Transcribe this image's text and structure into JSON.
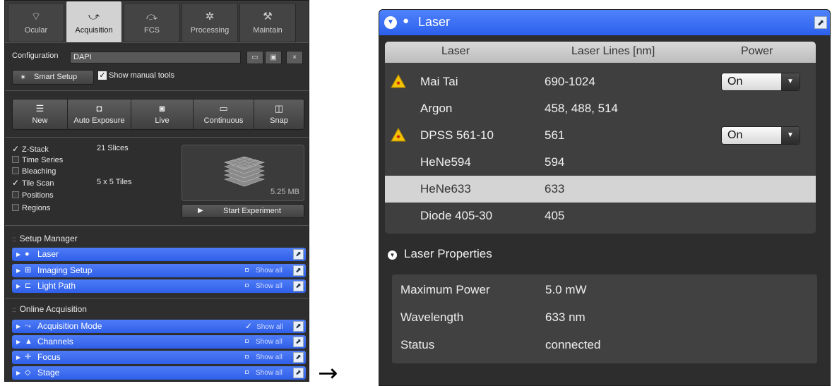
{
  "left": {
    "tabs": [
      {
        "label": "Ocular",
        "icon": "eyepiece-icon"
      },
      {
        "label": "Acquisition",
        "icon": "acquisition-icon"
      },
      {
        "label": "FCS",
        "icon": "fcs-icon"
      },
      {
        "label": "Processing",
        "icon": "processing-icon"
      },
      {
        "label": "Maintain",
        "icon": "maintain-icon"
      }
    ],
    "config_label": "Configuration",
    "config_value": "DAPI",
    "config_buttons": [
      "open-icon",
      "save-icon",
      "close-icon"
    ],
    "config_close": "×",
    "smart_setup": "Smart Setup",
    "show_manual_tools": "Show manual tools",
    "actions": [
      {
        "label": "New",
        "icon": "new-icon"
      },
      {
        "label": "Auto Exposure",
        "icon": "camera-icon"
      },
      {
        "label": "Live",
        "icon": "live-icon"
      },
      {
        "label": "Continuous",
        "icon": "continuous-icon"
      },
      {
        "label": "Snap",
        "icon": "snap-icon"
      }
    ],
    "experiment_options": [
      {
        "label": "Z-Stack",
        "checked": true,
        "value": "21 Slices"
      },
      {
        "label": "Time Series",
        "checked": false,
        "value": ""
      },
      {
        "label": "Bleaching",
        "checked": false,
        "value": ""
      },
      {
        "label": "Tile Scan",
        "checked": true,
        "value": "5 x 5 Tiles"
      },
      {
        "label": "Positions",
        "checked": false,
        "value": ""
      },
      {
        "label": "Regions",
        "checked": false,
        "value": ""
      }
    ],
    "preview_size": "5.25 MB",
    "start_experiment": "Start Experiment",
    "setup_manager_title": "Setup Manager",
    "setup_tools": [
      {
        "label": "Laser",
        "icon": "bulb-icon",
        "show_all": null
      },
      {
        "label": "Imaging Setup",
        "icon": "grid-icon",
        "show_all": "Show all",
        "checked": false
      },
      {
        "label": "Light Path",
        "icon": "lightpath-icon",
        "show_all": "Show all",
        "checked": false
      }
    ],
    "online_acquisition_title": "Online Acquisition",
    "acquisition_tools": [
      {
        "label": "Acquisition Mode",
        "icon": "mode-icon",
        "show_all": "Show all",
        "checked": true
      },
      {
        "label": "Channels",
        "icon": "channels-icon",
        "show_all": "Show all",
        "checked": false
      },
      {
        "label": "Focus",
        "icon": "focus-icon",
        "show_all": "Show all",
        "checked": false
      },
      {
        "label": "Stage",
        "icon": "stage-icon",
        "show_all": "Show all",
        "checked": false
      }
    ]
  },
  "arrow": "→",
  "right": {
    "title": "Laser",
    "columns": [
      "Laser",
      "Laser Lines [nm]",
      "Power"
    ],
    "lasers": [
      {
        "name": "Mai Tai",
        "lines": "690-1024",
        "power": "On",
        "warning": true,
        "selected": false
      },
      {
        "name": "Argon",
        "lines": "458, 488, 514",
        "power": null,
        "warning": false,
        "selected": false
      },
      {
        "name": "DPSS 561-10",
        "lines": "561",
        "power": "On",
        "warning": true,
        "selected": false
      },
      {
        "name": "HeNe594",
        "lines": "594",
        "power": null,
        "warning": false,
        "selected": false
      },
      {
        "name": "HeNe633",
        "lines": "633",
        "power": null,
        "warning": false,
        "selected": true
      },
      {
        "name": "Diode 405-30",
        "lines": "405",
        "power": null,
        "warning": false,
        "selected": false
      }
    ],
    "properties_title": "Laser Properties",
    "properties": [
      {
        "key": "Maximum Power",
        "value": "5.0 mW"
      },
      {
        "key": "Wavelength",
        "value": "633 nm"
      },
      {
        "key": "Status",
        "value": "connected"
      }
    ],
    "colors": {
      "accent_blue": "#3a6cf2",
      "warning_yellow": "#f5c400",
      "selected_row": "#d4d4d4"
    }
  }
}
